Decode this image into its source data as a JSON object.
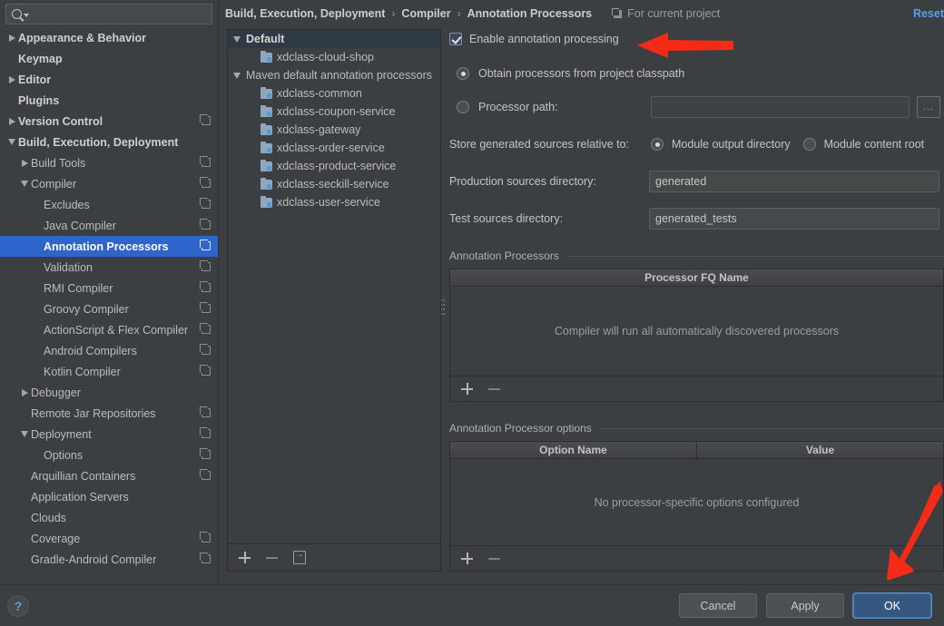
{
  "search": {
    "placeholder": "",
    "value": "",
    "icon": "search-icon"
  },
  "sidebar": {
    "items": [
      {
        "label": "Appearance & Behavior",
        "indent": 0,
        "twisty": "right",
        "bold": true,
        "copy": false,
        "selected": false
      },
      {
        "label": "Keymap",
        "indent": 0,
        "twisty": "none",
        "bold": true,
        "copy": false,
        "selected": false
      },
      {
        "label": "Editor",
        "indent": 0,
        "twisty": "right",
        "bold": true,
        "copy": false,
        "selected": false
      },
      {
        "label": "Plugins",
        "indent": 0,
        "twisty": "none",
        "bold": true,
        "copy": false,
        "selected": false
      },
      {
        "label": "Version Control",
        "indent": 0,
        "twisty": "right",
        "bold": true,
        "copy": true,
        "selected": false
      },
      {
        "label": "Build, Execution, Deployment",
        "indent": 0,
        "twisty": "down",
        "bold": true,
        "copy": false,
        "selected": false
      },
      {
        "label": "Build Tools",
        "indent": 1,
        "twisty": "right",
        "bold": false,
        "copy": true,
        "selected": false
      },
      {
        "label": "Compiler",
        "indent": 1,
        "twisty": "down",
        "bold": false,
        "copy": true,
        "selected": false
      },
      {
        "label": "Excludes",
        "indent": 2,
        "twisty": "none",
        "bold": false,
        "copy": true,
        "selected": false
      },
      {
        "label": "Java Compiler",
        "indent": 2,
        "twisty": "none",
        "bold": false,
        "copy": true,
        "selected": false
      },
      {
        "label": "Annotation Processors",
        "indent": 2,
        "twisty": "none",
        "bold": true,
        "copy": true,
        "selected": true
      },
      {
        "label": "Validation",
        "indent": 2,
        "twisty": "none",
        "bold": false,
        "copy": true,
        "selected": false
      },
      {
        "label": "RMI Compiler",
        "indent": 2,
        "twisty": "none",
        "bold": false,
        "copy": true,
        "selected": false
      },
      {
        "label": "Groovy Compiler",
        "indent": 2,
        "twisty": "none",
        "bold": false,
        "copy": true,
        "selected": false
      },
      {
        "label": "ActionScript & Flex Compiler",
        "indent": 2,
        "twisty": "none",
        "bold": false,
        "copy": true,
        "selected": false
      },
      {
        "label": "Android Compilers",
        "indent": 2,
        "twisty": "none",
        "bold": false,
        "copy": true,
        "selected": false
      },
      {
        "label": "Kotlin Compiler",
        "indent": 2,
        "twisty": "none",
        "bold": false,
        "copy": true,
        "selected": false
      },
      {
        "label": "Debugger",
        "indent": 1,
        "twisty": "right",
        "bold": false,
        "copy": false,
        "selected": false
      },
      {
        "label": "Remote Jar Repositories",
        "indent": 1,
        "twisty": "none",
        "bold": false,
        "copy": true,
        "selected": false
      },
      {
        "label": "Deployment",
        "indent": 1,
        "twisty": "down",
        "bold": false,
        "copy": true,
        "selected": false
      },
      {
        "label": "Options",
        "indent": 2,
        "twisty": "none",
        "bold": false,
        "copy": true,
        "selected": false
      },
      {
        "label": "Arquillian Containers",
        "indent": 1,
        "twisty": "none",
        "bold": false,
        "copy": true,
        "selected": false
      },
      {
        "label": "Application Servers",
        "indent": 1,
        "twisty": "none",
        "bold": false,
        "copy": false,
        "selected": false
      },
      {
        "label": "Clouds",
        "indent": 1,
        "twisty": "none",
        "bold": false,
        "copy": false,
        "selected": false
      },
      {
        "label": "Coverage",
        "indent": 1,
        "twisty": "none",
        "bold": false,
        "copy": true,
        "selected": false
      },
      {
        "label": "Gradle-Android Compiler",
        "indent": 1,
        "twisty": "none",
        "bold": false,
        "copy": true,
        "selected": false
      }
    ]
  },
  "header": {
    "breadcrumb": [
      "Build, Execution, Deployment",
      "Compiler",
      "Annotation Processors"
    ],
    "separator": "›",
    "scope_label": "For current project",
    "reset_label": "Reset"
  },
  "module_tree": {
    "rows": [
      {
        "label": "Default",
        "type": "group",
        "twisty": "down",
        "selected": true
      },
      {
        "label": "xdclass-cloud-shop",
        "type": "module",
        "twisty": "none",
        "selected": false
      },
      {
        "label": "Maven default annotation processors",
        "type": "group",
        "twisty": "down",
        "selected": false
      },
      {
        "label": "xdclass-common",
        "type": "module",
        "twisty": "none",
        "selected": false
      },
      {
        "label": "xdclass-coupon-service",
        "type": "module",
        "twisty": "none",
        "selected": false
      },
      {
        "label": "xdclass-gateway",
        "type": "module",
        "twisty": "none",
        "selected": false
      },
      {
        "label": "xdclass-order-service",
        "type": "module",
        "twisty": "none",
        "selected": false
      },
      {
        "label": "xdclass-product-service",
        "type": "module",
        "twisty": "none",
        "selected": false
      },
      {
        "label": "xdclass-seckill-service",
        "type": "module",
        "twisty": "none",
        "selected": false
      },
      {
        "label": "xdclass-user-service",
        "type": "module",
        "twisty": "none",
        "selected": false
      }
    ],
    "toolbar": {
      "add": "+",
      "remove": "−",
      "move": "move-to-icon"
    }
  },
  "settings": {
    "enable_annotation_processing": {
      "label": "Enable annotation processing",
      "checked": true
    },
    "obtain_from_classpath": {
      "label": "Obtain processors from project classpath",
      "selected": true
    },
    "processor_path": {
      "label": "Processor path:",
      "selected": false,
      "value": "",
      "browse_label": "..."
    },
    "store_relative_label": "Store generated sources relative to:",
    "store_options": [
      {
        "label": "Module output directory",
        "selected": true
      },
      {
        "label": "Module content root",
        "selected": false
      }
    ],
    "production_sources": {
      "label": "Production sources directory:",
      "value": "generated"
    },
    "test_sources": {
      "label": "Test sources directory:",
      "value": "generated_tests"
    }
  },
  "processors_section": {
    "title": "Annotation Processors",
    "columns": [
      "Processor FQ Name"
    ],
    "empty_text": "Compiler will run all automatically discovered processors",
    "toolbar": {
      "add": "+",
      "remove": "−"
    }
  },
  "options_section": {
    "title": "Annotation Processor options",
    "columns": [
      "Option Name",
      "Value"
    ],
    "empty_text": "No processor-specific options configured",
    "toolbar": {
      "add": "+",
      "remove": "−"
    }
  },
  "footer": {
    "help_label": "?",
    "cancel_label": "Cancel",
    "apply_label": "Apply",
    "ok_label": "OK"
  },
  "annotations": {
    "arrow_color": "#f32b17",
    "arrow_top_target": "enable-annotation-processing-checkbox",
    "arrow_bottom_target": "ok-button"
  },
  "colors": {
    "window_bg": "#3c3f41",
    "selection_blue": "#2f65ca",
    "link_blue": "#589df6",
    "primary_button": "#365880",
    "field_bg": "#45494a",
    "module_icon": "#8fa6be"
  }
}
